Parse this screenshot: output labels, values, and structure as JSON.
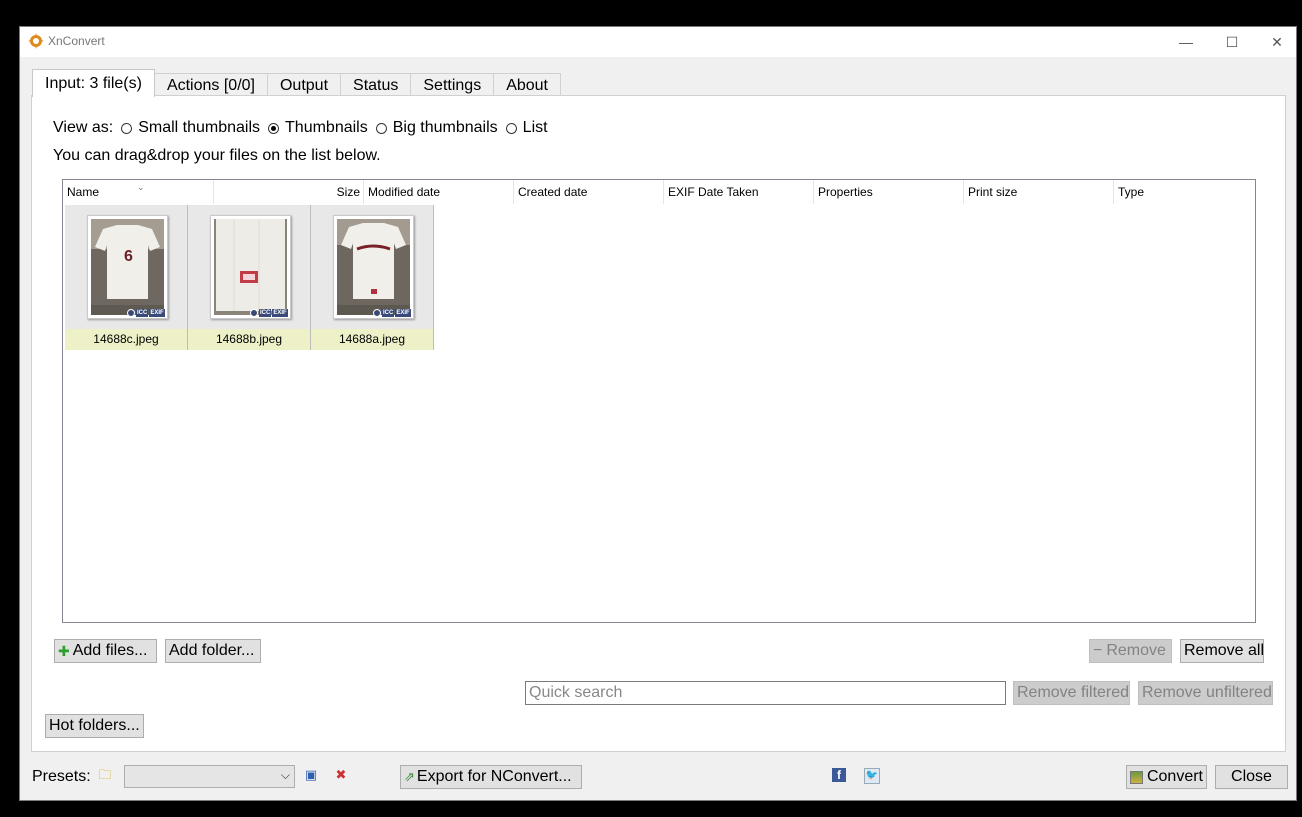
{
  "window": {
    "title": "XnConvert",
    "controls": {
      "minimize": "—",
      "maximize": "☐",
      "close": "✕"
    }
  },
  "tabs": [
    {
      "label": "Input: 3 file(s)",
      "active": true
    },
    {
      "label": "Actions [0/0]"
    },
    {
      "label": "Output"
    },
    {
      "label": "Status"
    },
    {
      "label": "Settings"
    },
    {
      "label": "About"
    }
  ],
  "input": {
    "view_as_label": "View as:",
    "view_options": [
      {
        "label": "Small thumbnails",
        "checked": false
      },
      {
        "label": "Thumbnails",
        "checked": true
      },
      {
        "label": "Big thumbnails",
        "checked": false
      },
      {
        "label": "List",
        "checked": false
      }
    ],
    "hint": "You can drag&drop your files on the list below.",
    "columns": [
      "Name",
      "Size",
      "Modified date",
      "Created date",
      "EXIF Date Taken",
      "Properties",
      "Print size",
      "Type"
    ],
    "files": [
      {
        "name": "14688c.jpeg",
        "badges": [
          "ICC",
          "EXIF"
        ]
      },
      {
        "name": "14688b.jpeg",
        "badges": [
          "ICC",
          "EXIF"
        ]
      },
      {
        "name": "14688a.jpeg",
        "badges": [
          "ICC",
          "EXIF"
        ]
      }
    ],
    "buttons": {
      "add_files": "Add files...",
      "add_folder": "Add folder...",
      "remove": "Remove",
      "remove_all": "Remove all",
      "remove_filtered": "Remove filtered",
      "remove_unfiltered": "Remove unfiltered",
      "hot_folders": "Hot folders..."
    },
    "quick_search_placeholder": "Quick search"
  },
  "bottom": {
    "presets_label": "Presets:",
    "export_label": "Export for NConvert...",
    "convert_label": "Convert",
    "close_label": "Close"
  }
}
